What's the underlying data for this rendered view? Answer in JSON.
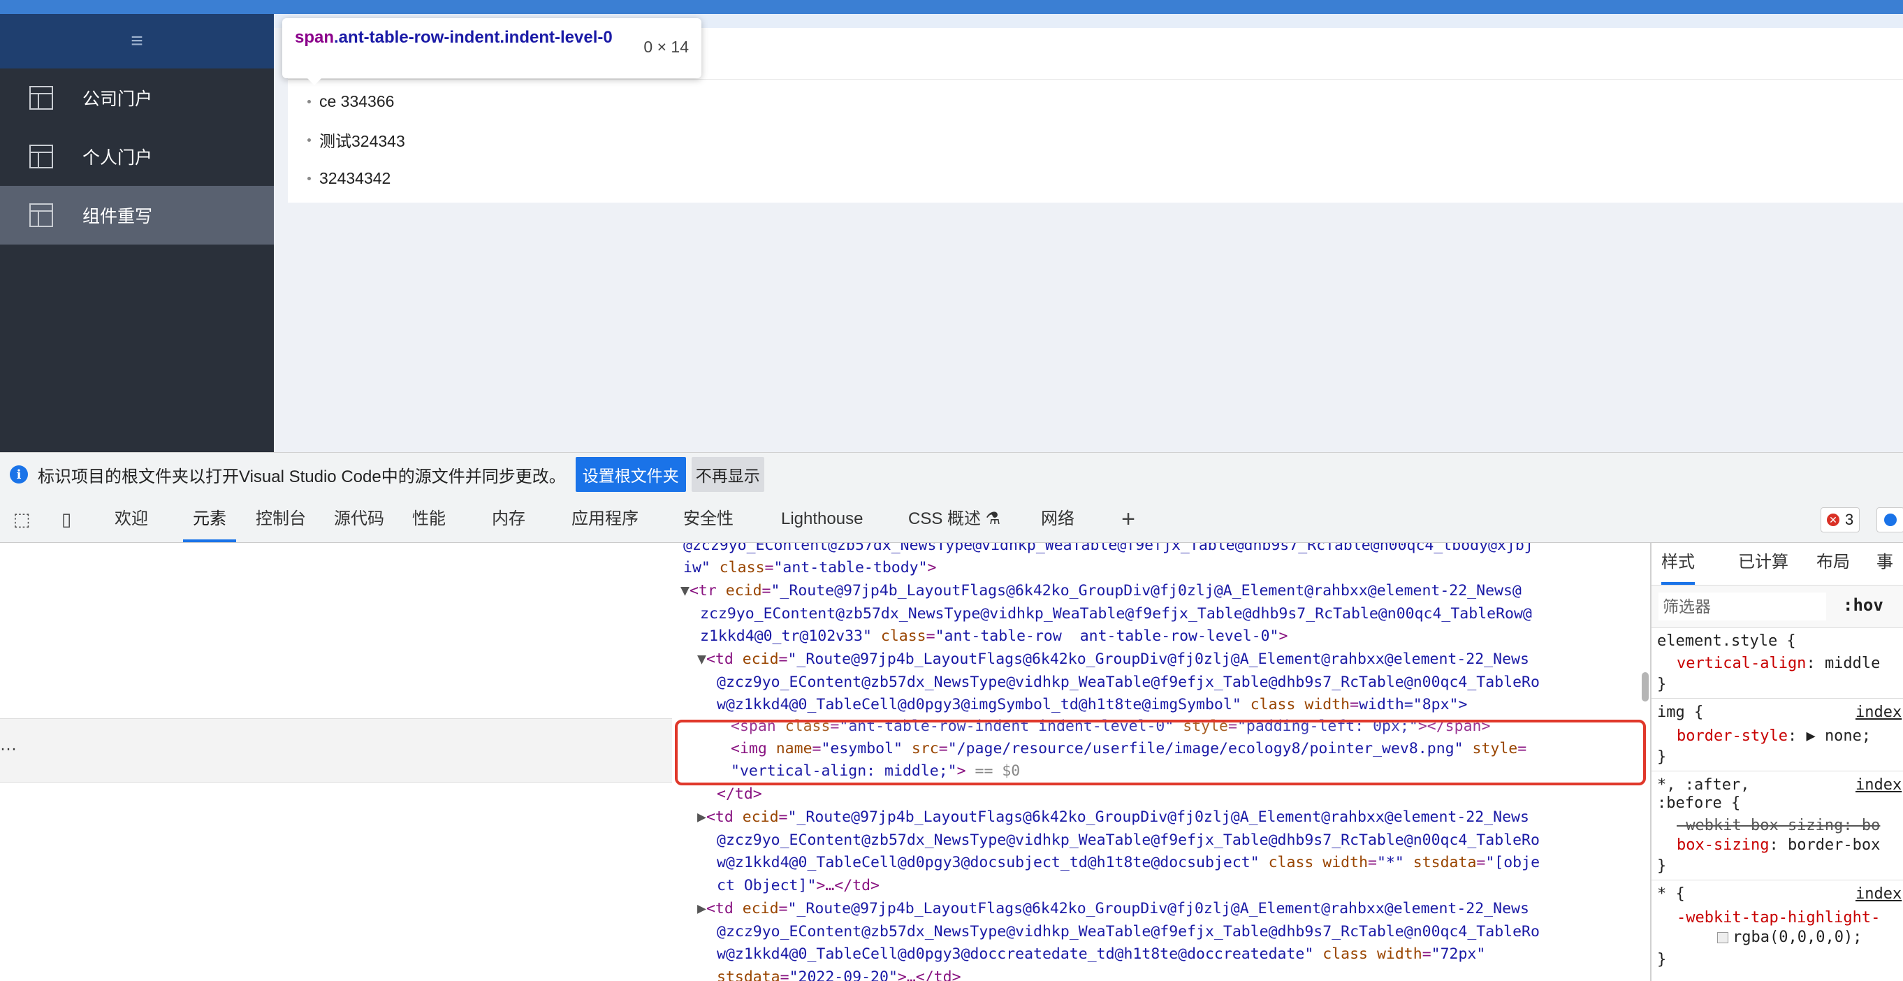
{
  "sidebar": {
    "collapse_glyph": "≡",
    "items": [
      {
        "label": "公司门户",
        "active": false
      },
      {
        "label": "个人门户",
        "active": false
      },
      {
        "label": "组件重写",
        "active": true
      }
    ]
  },
  "content": {
    "rows": [
      "ce 334366",
      "测试324343",
      "32434342"
    ]
  },
  "tooltip": {
    "tag": "span",
    "classes": ".ant-table-row-indent.indent-level-0",
    "size": "0 × 14"
  },
  "infobar": {
    "message": "标识项目的根文件夹以打开Visual Studio Code中的源文件并同步更改。",
    "primary_button": "设置根文件夹",
    "secondary_button": "不再显示"
  },
  "devtools": {
    "tabs": [
      "欢迎",
      "元素",
      "控制台",
      "源代码",
      "性能",
      "内存",
      "应用程序",
      "安全性",
      "Lighthouse",
      "CSS 概述 ⚗",
      "网络"
    ],
    "active_tab": "元素",
    "error_count": "3",
    "gutter_ellipsis": "···"
  },
  "elements_tree": {
    "line1": "@zcz9yo_EContent@zb57dx_NewsType@vidhkp_WeaTable@f9efjx_Table@dhb9s7_RcTable@n00qc4_tbody@xjbj",
    "line2_attr_tail": "iw\"",
    "line2_attr": "class",
    "line2_val": "\"ant-table-tbody\"",
    "tr_ecid_1": "\"_Route@97jp4b_LayoutFlags@6k42ko_GroupDiv@fj0zlj@A_Element@rahbxx@element-22_News@",
    "tr_ecid_2": "zcz9yo_EContent@zb57dx_NewsType@vidhkp_WeaTable@f9efjx_Table@dhb9s7_RcTable@n00qc4_TableRow@",
    "tr_ecid_3": "z1kkd4@0_tr@102v33\"",
    "tr_class": "\"ant-table-row  ant-table-row-level-0\"",
    "td1_ecid_1": "\"_Route@97jp4b_LayoutFlags@6k42ko_GroupDiv@fj0zlj@A_Element@rahbxx@element-22_News",
    "td1_ecid_2": "@zcz9yo_EContent@zb57dx_NewsType@vidhkp_WeaTable@f9efjx_Table@dhb9s7_RcTable@n00qc4_TableRo",
    "td1_ecid_3": "w@z1kkd4@0_TableCell@d0pgy3@imgSymbol_td@h1t8te@imgSymbol\"",
    "td1_tail": "width=\"8px\">",
    "span_class": "\"ant-table-row-indent indent-level-0\"",
    "span_style": "\"padding-left: 0px;\"",
    "img_name": "\"esymbol\"",
    "img_src": "\"/page/resource/userfile/image/ecology8/pointer_wev8.png\"",
    "img_style": "\"vertical-align: middle;\"",
    "dollar0": " == $0",
    "td2_ecid_3": "w@z1kkd4@0_TableCell@d0pgy3@docsubject_td@h1t8te@docsubject\"",
    "td2_width": "\"*\"",
    "td2_stsdata_a": "\"[obje",
    "td2_stsdata_b": "ct Object]\"",
    "td3_ecid_3": "w@z1kkd4@0_TableCell@d0pgy3@doccreatedate_td@h1t8te@doccreatedate\"",
    "td3_width": "\"72px\"",
    "td3_stsdata": "\"2022-09-20\""
  },
  "styles_panel": {
    "tabs": [
      "样式",
      "已计算",
      "布局",
      "事件"
    ],
    "filter_placeholder": "筛选器",
    "hov": ":hov",
    "rules": {
      "element_style": "element.style {",
      "va_prop": "vertical-align",
      "va_val": "middle",
      "img_sel": "img {",
      "img_link": "index",
      "bs_prop": "border-style",
      "bs_val": "none;",
      "star_sel_1": "*, :after,",
      "star_sel_2": ":before {",
      "star_link": "index",
      "wbs": "-webkit-box-sizing: bo",
      "bs2_prop": "box-sizing",
      "bs2_val": "border-box",
      "star2_sel": "* {",
      "star2_link": "index",
      "thc": "-webkit-tap-highlight-",
      "rgba": "rgba(0,0,0,0);"
    }
  }
}
